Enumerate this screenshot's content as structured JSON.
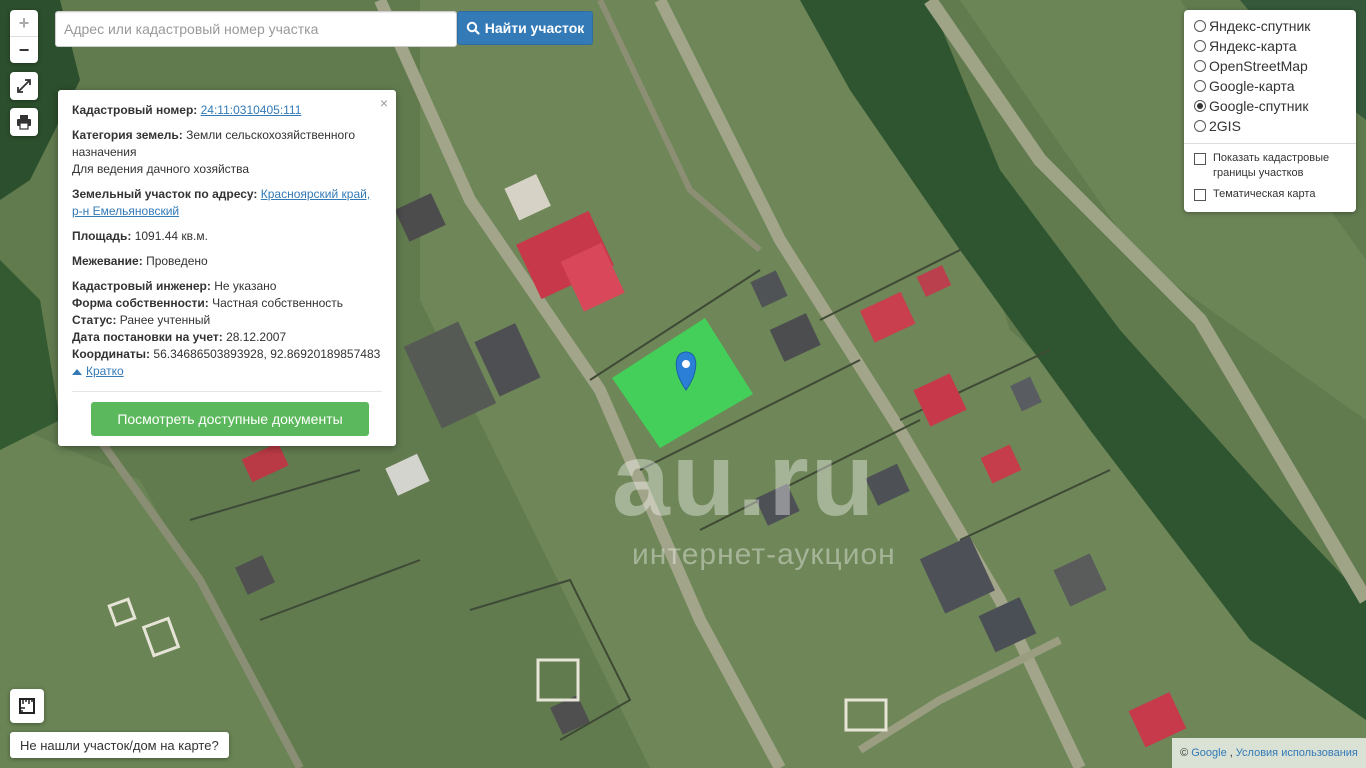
{
  "search": {
    "placeholder": "Адрес или кадастровый номер участка",
    "button_label": "Найти участок"
  },
  "zoom": {
    "plus": "+",
    "minus": "−"
  },
  "popup": {
    "close": "×",
    "cadastral_label": "Кадастровый номер:",
    "cadastral_value": "24:11:0310405:111",
    "category_label": "Категория земель:",
    "category_value": "Земли сельскохозяйственного назначения",
    "category_use": "Для ведения дачного хозяйства",
    "address_label": "Земельный участок по адресу:",
    "address_value": "Красноярский край, р-н Емельяновский",
    "area_label": "Площадь:",
    "area_value": "1091.44 кв.м.",
    "survey_label": "Межевание:",
    "survey_value": "Проведено",
    "engineer_label": "Кадастровый инженер:",
    "engineer_value": "Не указано",
    "ownership_label": "Форма собственности:",
    "ownership_value": "Частная собственность",
    "status_label": "Статус:",
    "status_value": "Ранее учтенный",
    "date_label": "Дата постановки на учет:",
    "date_value": "28.12.2007",
    "coords_label": "Координаты:",
    "coords_value": "56.34686503893928, 92.86920189857483",
    "short_link": "Кратко",
    "docs_button": "Посмотреть доступные документы"
  },
  "layers": {
    "options": [
      {
        "label": "Яндекс-спутник",
        "selected": false
      },
      {
        "label": "Яндекс-карта",
        "selected": false
      },
      {
        "label": "OpenStreetMap",
        "selected": false
      },
      {
        "label": "Google-карта",
        "selected": false
      },
      {
        "label": "Google-спутник",
        "selected": true
      },
      {
        "label": "2GIS",
        "selected": false
      }
    ],
    "show_boundaries": "Показать кадастровые границы участков",
    "thematic_map": "Тематическая карта"
  },
  "bottom": {
    "not_found": "Не нашли участок/дом на карте?",
    "attrib_copy": "©",
    "attrib_google": "Google",
    "attrib_terms": "Условия использования"
  },
  "watermark": {
    "logo": "au.ru",
    "tagline": "интернет-аукцион"
  },
  "colors": {
    "parcel": "#3ddc5a",
    "marker": "#2b7fd6",
    "primary_btn": "#337ab7",
    "success_btn": "#5cb85c"
  }
}
